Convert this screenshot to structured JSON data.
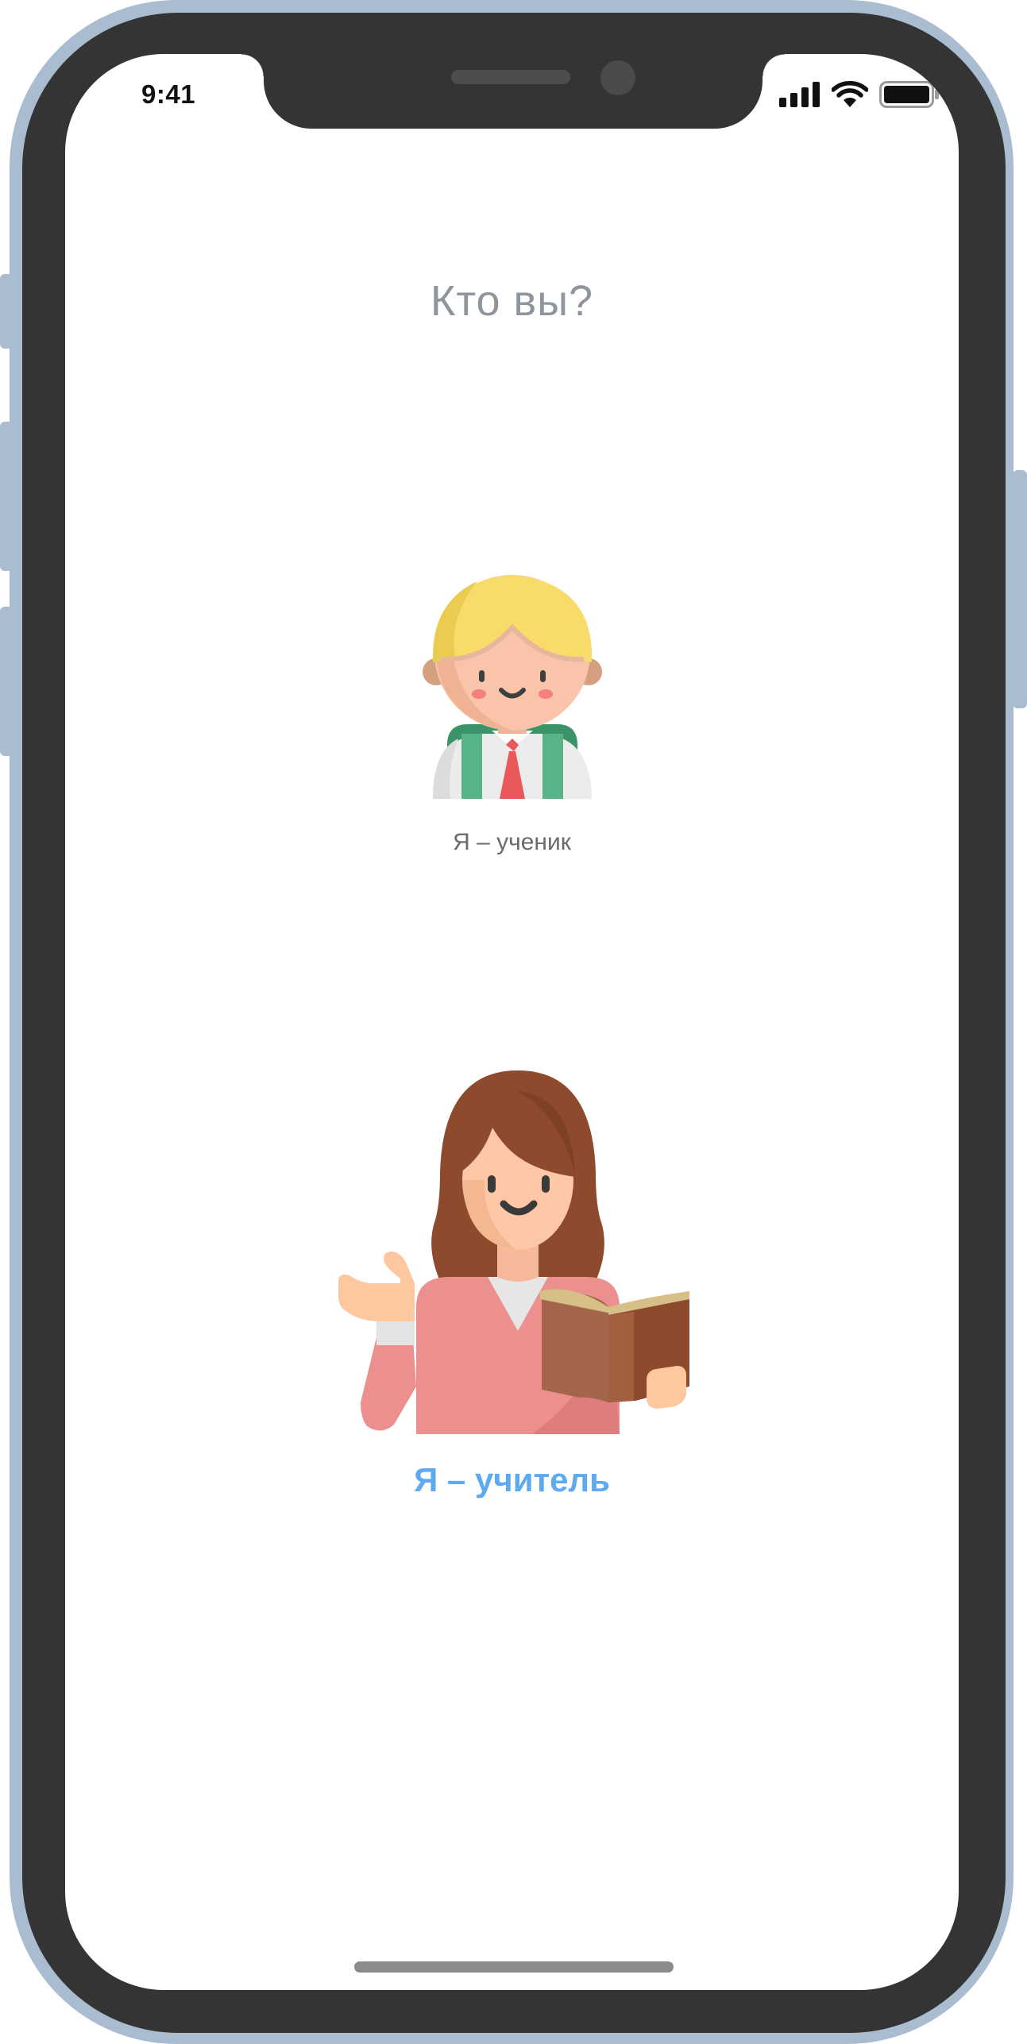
{
  "status_bar": {
    "time": "9:41",
    "signal_icon": "cellular-signal-icon",
    "wifi_icon": "wifi-icon",
    "battery_icon": "battery-icon"
  },
  "screen": {
    "title": "Кто вы?"
  },
  "options": [
    {
      "label": "Я – ученик",
      "icon": "student-avatar-icon",
      "color": "#6a6a6a"
    },
    {
      "label": "Я – учитель",
      "icon": "teacher-avatar-icon",
      "color": "#5daaf0"
    }
  ],
  "colors": {
    "device_frame": "#aabdd0",
    "bezel": "#343434",
    "title": "#8e959d",
    "teacher_accent": "#5daaf0"
  }
}
